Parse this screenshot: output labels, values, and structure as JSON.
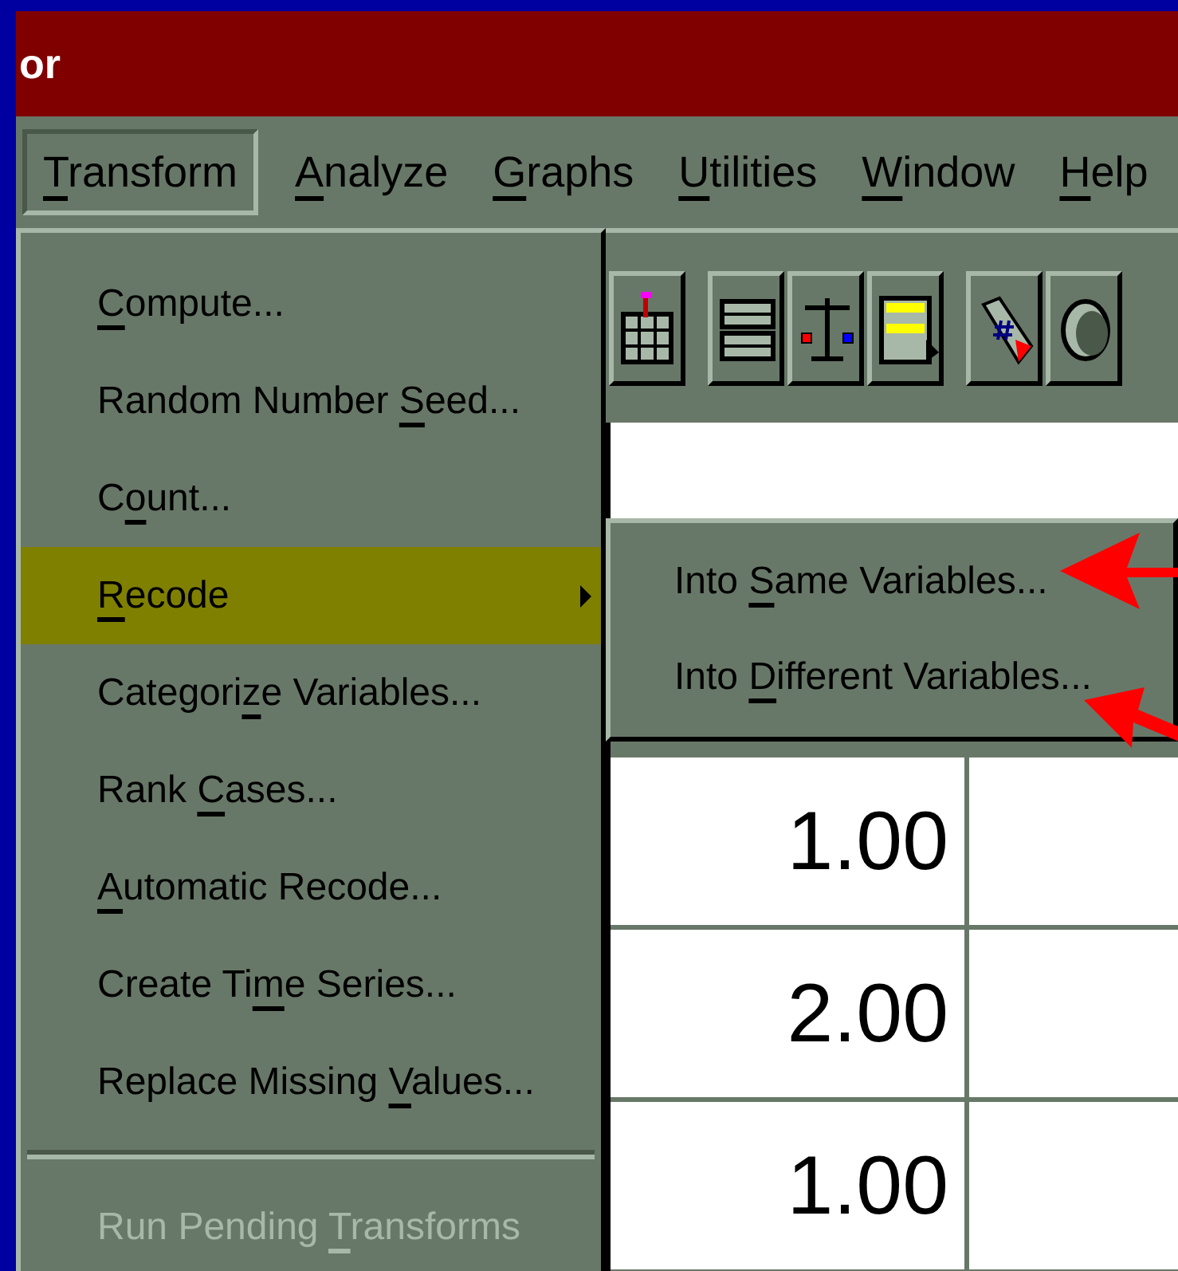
{
  "window": {
    "title": "or"
  },
  "menu_bar": [
    {
      "key": "T",
      "post": "ransform",
      "selected": true
    },
    {
      "key": "A",
      "post": "nalyze",
      "selected": false
    },
    {
      "key": "G",
      "post": "raphs",
      "selected": false
    },
    {
      "key": "U",
      "post": "tilities",
      "selected": false
    },
    {
      "key": "W",
      "post": "indow",
      "selected": false
    },
    {
      "key": "H",
      "post": "elp",
      "selected": false
    }
  ],
  "transform_menu": [
    {
      "kind": "item",
      "key": "C",
      "post": "ompute...",
      "selected": false,
      "disabled": false,
      "submenu": false
    },
    {
      "kind": "item",
      "pre": "Random Number ",
      "key": "S",
      "post": "eed...",
      "selected": false,
      "disabled": false,
      "submenu": false
    },
    {
      "kind": "item",
      "pre": "C",
      "key": "o",
      "post": "unt...",
      "selected": false,
      "disabled": false,
      "submenu": false
    },
    {
      "kind": "item",
      "key": "R",
      "post": "ecode",
      "selected": true,
      "disabled": false,
      "submenu": true
    },
    {
      "kind": "item",
      "pre": "Categori",
      "key": "z",
      "post": "e Variables...",
      "selected": false,
      "disabled": false,
      "submenu": false
    },
    {
      "kind": "item",
      "pre": "Rank ",
      "key": "C",
      "post": "ases...",
      "selected": false,
      "disabled": false,
      "submenu": false
    },
    {
      "kind": "item",
      "key": "A",
      "post": "utomatic Recode...",
      "selected": false,
      "disabled": false,
      "submenu": false
    },
    {
      "kind": "item",
      "pre": "Create Ti",
      "key": "m",
      "post": "e Series...",
      "selected": false,
      "disabled": false,
      "submenu": false
    },
    {
      "kind": "item",
      "pre": "Replace Missing ",
      "key": "V",
      "post": "alues...",
      "selected": false,
      "disabled": false,
      "submenu": false
    },
    {
      "kind": "separator"
    },
    {
      "kind": "item",
      "pre": "Run Pending ",
      "key": "T",
      "post": "ransforms",
      "selected": false,
      "disabled": true,
      "submenu": false
    }
  ],
  "recode_submenu": [
    {
      "pre": "Into ",
      "key": "S",
      "post": "ame Variables..."
    },
    {
      "pre": "Into ",
      "key": "D",
      "post": "ifferent Variables..."
    }
  ],
  "data_grid": {
    "rows": [
      [
        "1.00"
      ],
      [
        "2.00"
      ],
      [
        "1.00"
      ]
    ]
  }
}
